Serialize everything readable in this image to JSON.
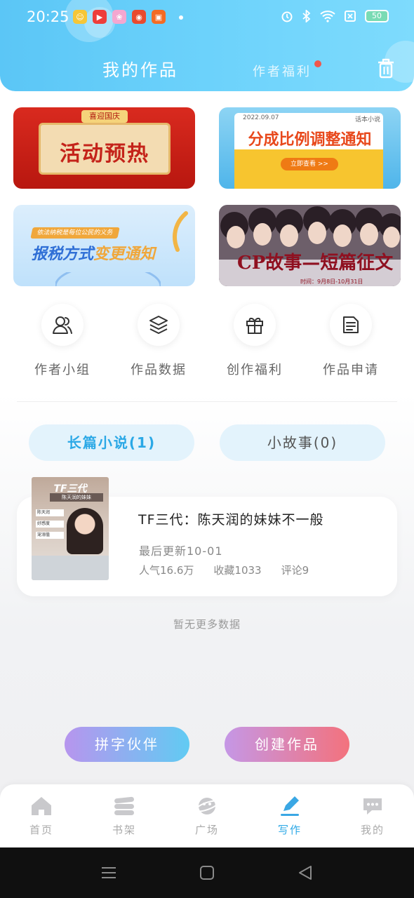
{
  "statusbar": {
    "time": "20:25",
    "battery": "50",
    "apps": [
      {
        "icon": "assistant-app-icon",
        "glyph": "☺",
        "color": "#f6c637"
      },
      {
        "icon": "video-app-icon",
        "glyph": "▶",
        "color": "#ee3e3a"
      },
      {
        "icon": "pink-app-icon",
        "glyph": "❀",
        "color": "#f4a7d0"
      },
      {
        "icon": "weibo-icon",
        "glyph": "◉",
        "color": "#e94a2e"
      },
      {
        "icon": "kuaishou-icon",
        "glyph": "▣",
        "color": "#f36b23"
      }
    ]
  },
  "header": {
    "title": "我的作品",
    "tab_welfare": "作者福利"
  },
  "banners": {
    "b1_tag": "喜迎国庆",
    "b1_text": "活动预热",
    "b2_date": "2022.09.07",
    "b2_source": "话本小说",
    "b2_text": "分成比例调整通知",
    "b2_button": "立即查看 >>",
    "b3_pill": "依法纳税是每位公民的义务",
    "b3_text_a": "报税方式",
    "b3_text_b": "变更通知",
    "b4_text": "CP故事—短篇征文",
    "b4_small": "时间：9月8日-10月31日"
  },
  "quick": [
    {
      "label": "作者小组",
      "icon": "author-group-icon"
    },
    {
      "label": "作品数据",
      "icon": "work-data-icon"
    },
    {
      "label": "创作福利",
      "icon": "gift-icon"
    },
    {
      "label": "作品申请",
      "icon": "application-doc-icon"
    }
  ],
  "tabs": {
    "long": "长篇小说(1)",
    "short": "小故事(0)"
  },
  "work": {
    "cover_title": "TF三代",
    "cover_subtitle": "陈天润的妹妹",
    "cover_list": [
      "陈天润",
      "好感度",
      "宠溺值"
    ],
    "title": "TF三代：陈天润的妹妹不一般",
    "updated": "最后更新10-01",
    "popularity": "人气16.6万",
    "favorites": "收藏1033",
    "comments": "评论9"
  },
  "no_more": "暂无更多数据",
  "actions": {
    "partner": "拼字伙伴",
    "create": "创建作品"
  },
  "nav": {
    "items": [
      {
        "label": "首页",
        "icon": "home-icon"
      },
      {
        "label": "书架",
        "icon": "bookshelf-icon"
      },
      {
        "label": "广场",
        "icon": "plaza-planet-icon"
      },
      {
        "label": "写作",
        "icon": "write-pen-icon",
        "active": true
      },
      {
        "label": "我的",
        "icon": "profile-chat-icon"
      }
    ]
  },
  "colors": {
    "accent": "#2ba8e6",
    "header": "#5bc6f6"
  }
}
